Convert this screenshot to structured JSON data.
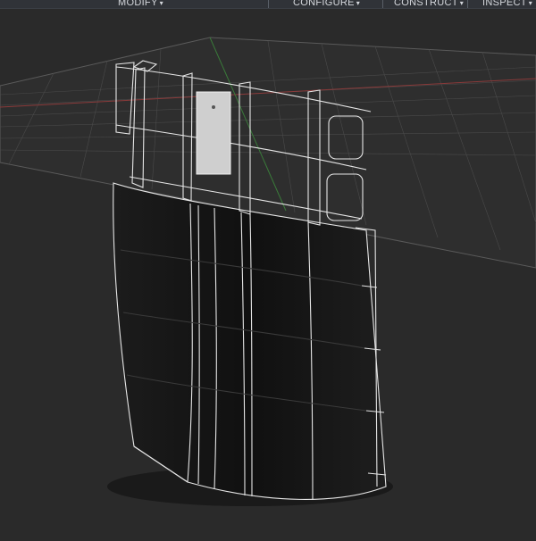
{
  "toolbar": {
    "menus": [
      {
        "label": "MODIFY"
      },
      {
        "label": "CONFIGURE"
      },
      {
        "label": "CONSTRUCT"
      },
      {
        "label": "INSPECT"
      }
    ],
    "caret": "▾"
  },
  "viewport": {
    "background": "#2a2a2a",
    "grid_color": "#4a4a4a",
    "axis_red": "#8a3a3a",
    "axis_green": "#3a7a3a",
    "model_edge": "#e6e6e6",
    "panel_color": "#cfcfcf"
  },
  "icons": [
    "caret-down-icon"
  ]
}
